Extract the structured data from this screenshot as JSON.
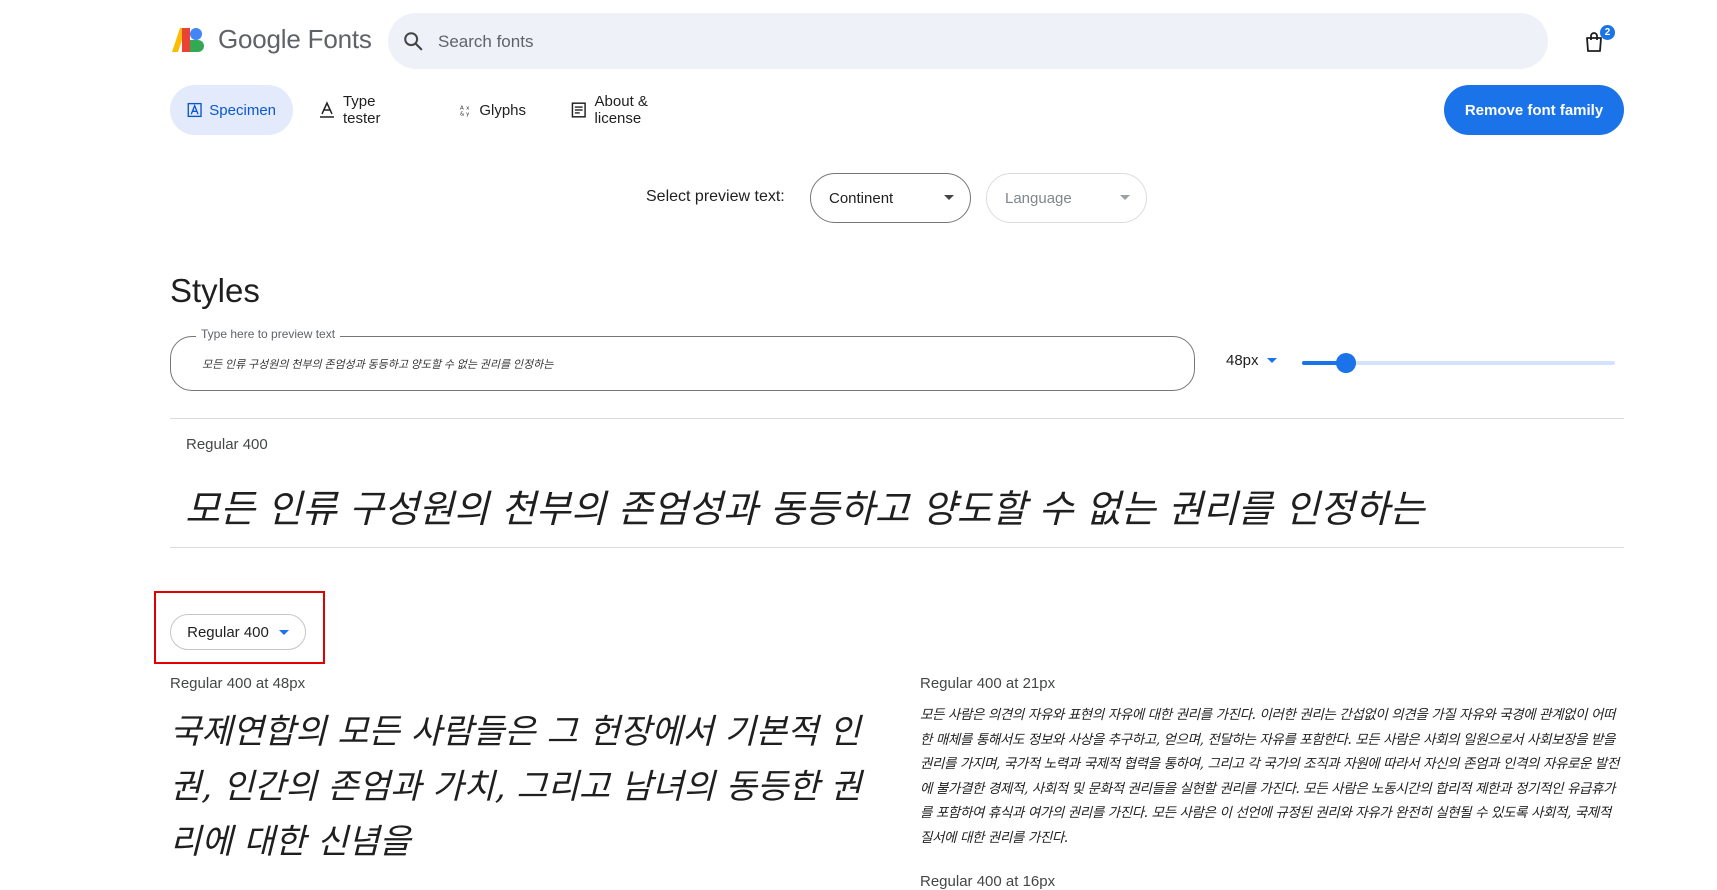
{
  "header": {
    "brand": "Google Fonts",
    "search_placeholder": "Search fonts",
    "cart_count": "2"
  },
  "tabs": [
    {
      "label": "Specimen",
      "active": true
    },
    {
      "label": "Type tester",
      "active": false
    },
    {
      "label": "Glyphs",
      "active": false
    },
    {
      "label": "About & license",
      "active": false
    }
  ],
  "remove_button": "Remove font family",
  "preview": {
    "label": "Select preview text:",
    "continent": "Continent",
    "language": "Language"
  },
  "styles": {
    "heading": "Styles",
    "input_legend": "Type here to preview text",
    "input_value": "모든 인류 구성원의 천부의 존엄성과 동등하고 양도할 수 없는 권리를 인정하는",
    "size": "48px",
    "size_fraction": 0.14,
    "style_label": "Regular 400",
    "sample_text": "모든 인류 구성원의 천부의 존엄성과 동등하고 양도할 수 없는 권리를 인정하는"
  },
  "specimen": {
    "weight_selector": "Regular 400",
    "large_label": "Regular 400 at 48px",
    "large_text": "국제연합의 모든 사람들은 그 헌장에서 기본적 인권, 인간의 존엄과 가치, 그리고 남녀의 동등한 권리에 대한 신념을",
    "medium_label": "Regular 400 at 21px",
    "medium_text": "모든 사람은 의견의 자유와 표현의 자유에 대한 권리를 가진다. 이러한 권리는 간섭없이 의견을 가질 자유와 국경에 관계없이 어떠한 매체를 통해서도 정보와 사상을 추구하고, 얻으며, 전달하는 자유를 포함한다. 모든 사람은 사회의 일원으로서 사회보장을 받을 권리를 가지며, 국가적 노력과 국제적 협력을 통하여, 그리고 각 국가의 조직과 자원에 따라서 자신의 존엄과 인격의 자유로운 발전에 불가결한 경제적, 사회적 및 문화적 권리들을 실현할 권리를 가진다. 모든 사람은 노동시간의 합리적 제한과 정기적인 유급휴가를 포함하여 휴식과 여가의 권리를 가진다. 모든 사람은 이 선언에 규정된 권리와 자유가 완전히 실현될 수 있도록 사회적, 국제적 질서에 대한 권리를 가진다.",
    "small_label": "Regular 400 at 16px"
  },
  "colors": {
    "accent": "#1a73e8",
    "active_tab_bg": "#e2eafb",
    "highlight": "#e00000"
  }
}
